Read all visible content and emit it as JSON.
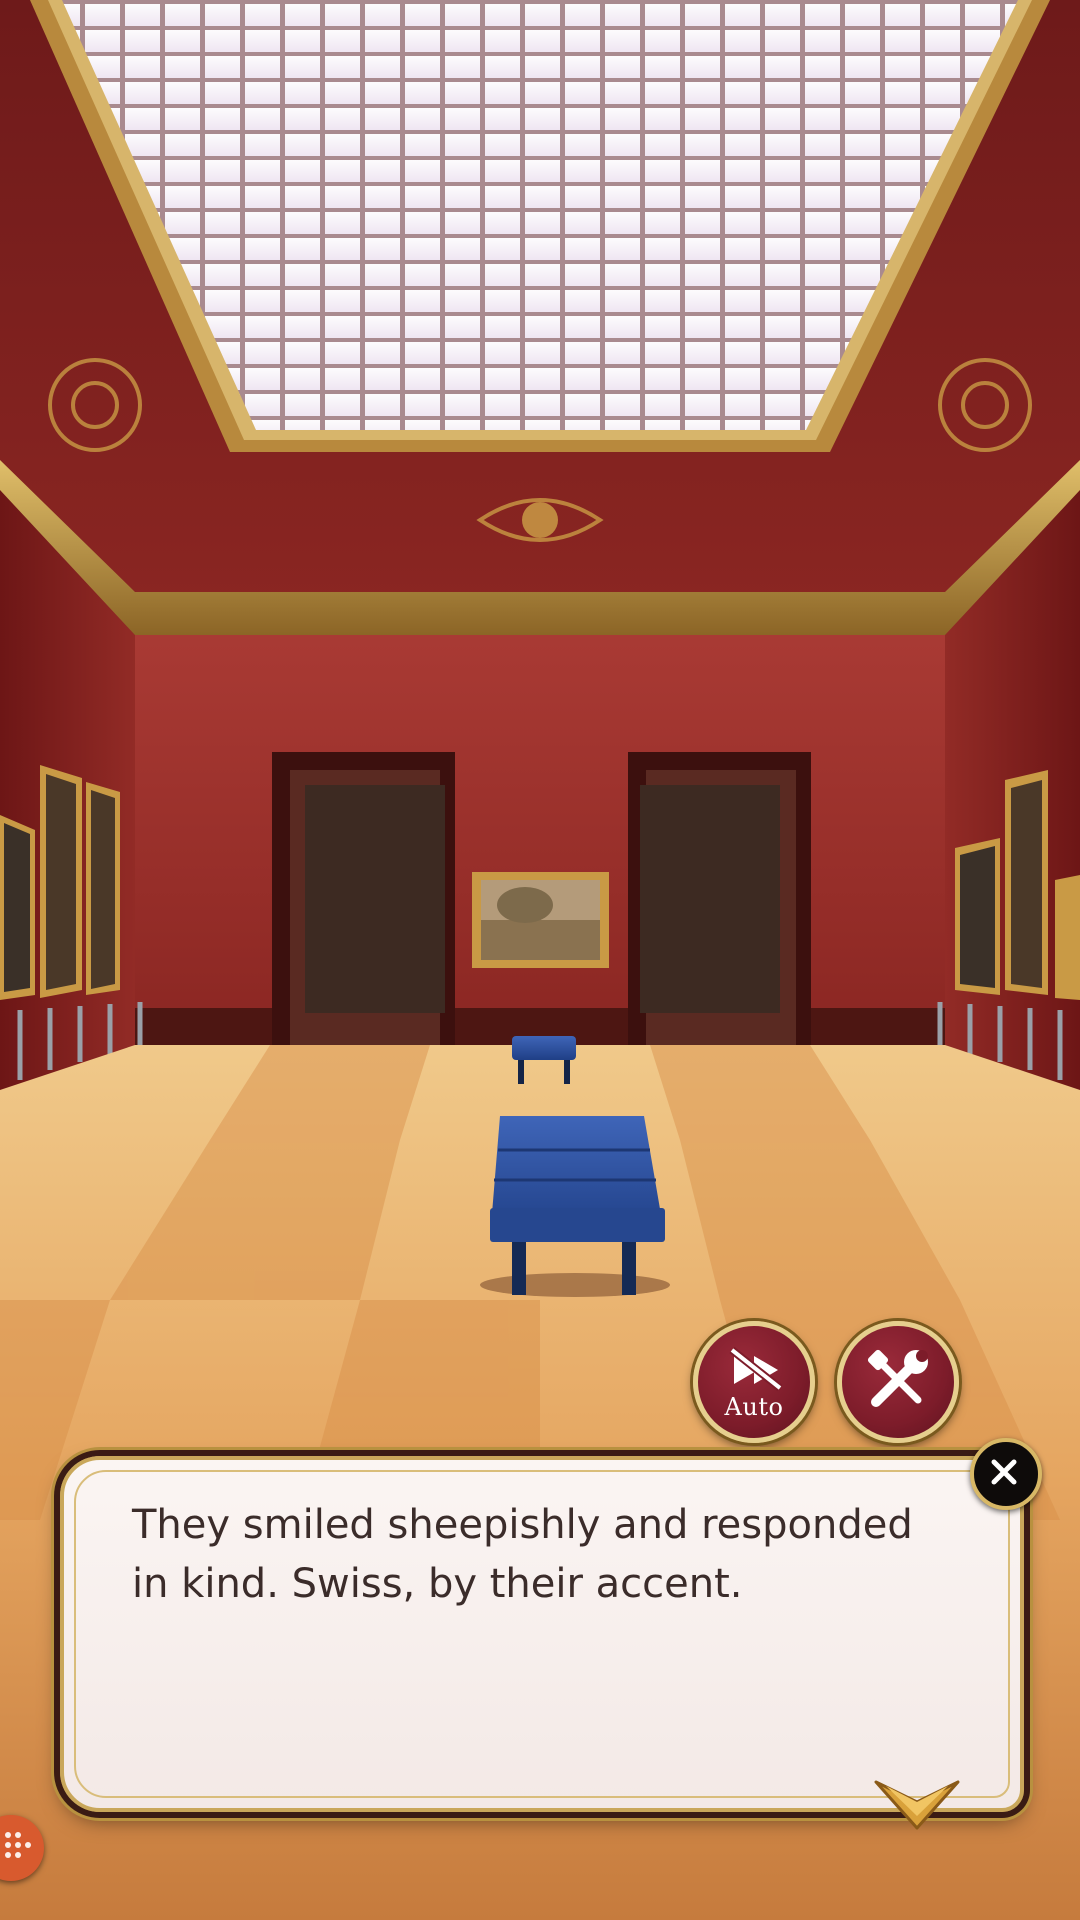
{
  "dialogue": {
    "text": "They smiled sheepishly and responded in kind. Swiss, by their accent."
  },
  "controls": {
    "auto_label": "Auto",
    "auto_icon": "skip-off-icon",
    "settings_icon": "wrench-screwdriver-icon",
    "close_icon": "close-icon",
    "next_icon": "chevron-down-icon"
  },
  "colors": {
    "wall_red": "#8e2a26",
    "gold_trim": "#c9a75a",
    "button_maroon": "#7d1c2a",
    "dialogue_bg": "#fbf5f3",
    "dialogue_text": "#3b2c2a",
    "corner_button": "#d85a2e"
  }
}
